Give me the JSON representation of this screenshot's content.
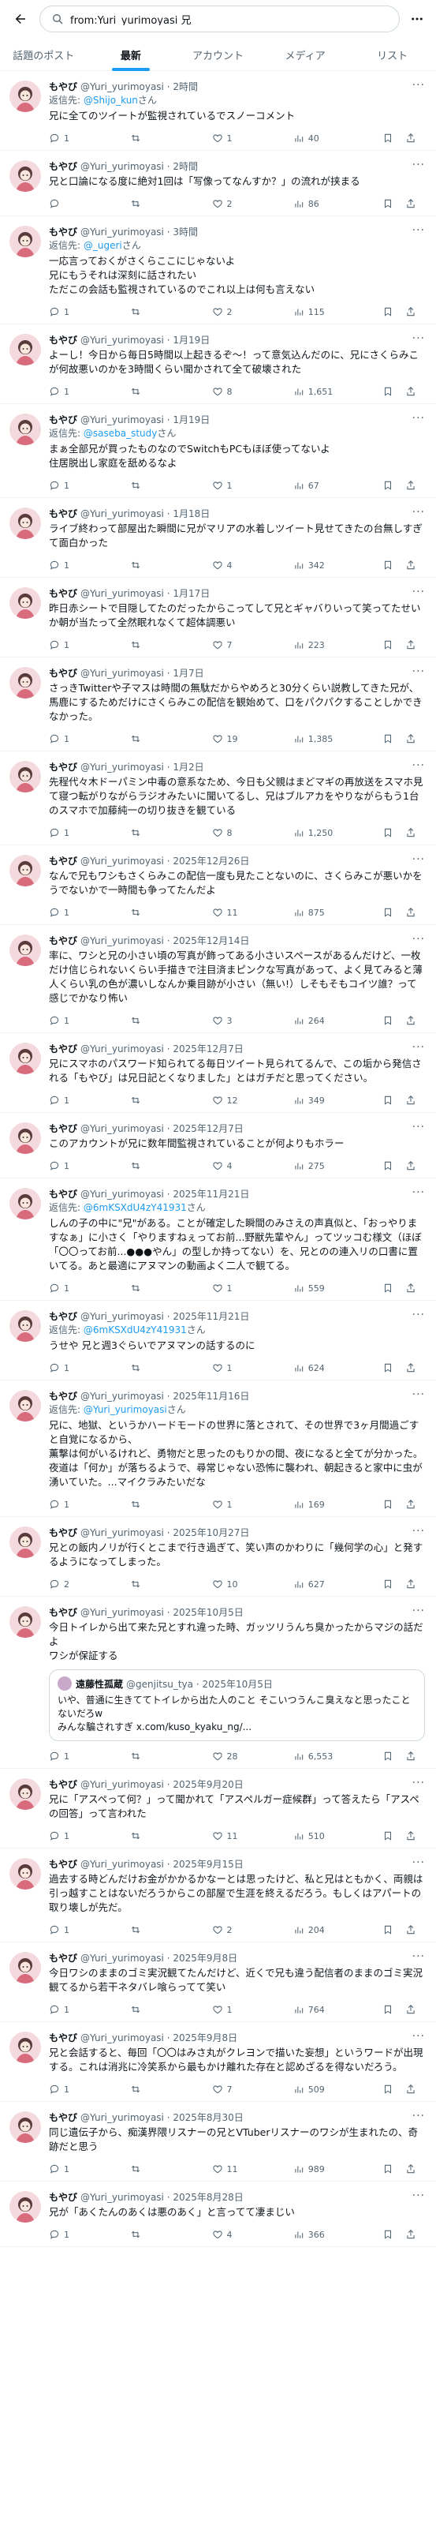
{
  "search": {
    "value": "from:Yuri_yurimoyasi 兄"
  },
  "tabs": [
    {
      "label": "話題のポスト"
    },
    {
      "label": "最新"
    },
    {
      "label": "アカウント"
    },
    {
      "label": "メディア"
    },
    {
      "label": "リスト"
    }
  ],
  "reply_prefix": "返信先:",
  "tweets": [
    {
      "name": "もやび",
      "handle": "@Yuri_yurimoyasi · 2時間",
      "reply_to": "@Shijo_kun",
      "reply_suffix": "さん",
      "text": "兄に全てのツイートが監視されているでスノーコメント",
      "replies": "1",
      "reposts": "",
      "likes": "1",
      "views": "40"
    },
    {
      "name": "もやび",
      "handle": "@Yuri_yurimoyasi · 2時間",
      "reply_to": "",
      "reply_suffix": "",
      "text": "兄と口論になる度に絶対1回は「写像ってなんすか？」の流れが挟まる",
      "replies": "",
      "reposts": "",
      "likes": "2",
      "views": "86"
    },
    {
      "name": "もやび",
      "handle": "@Yuri_yurimoyasi · 3時間",
      "reply_to": "@_ugeri",
      "reply_suffix": "さん",
      "text": "一応言っておくがさくらここにじゃないよ\n兄にもうそれは深刻に話されたい\nただこの会話も監視されているのでこれ以上は何も言えない",
      "replies": "1",
      "reposts": "",
      "likes": "2",
      "views": "115"
    },
    {
      "name": "もやび",
      "handle": "@Yuri_yurimoyasi · 1月19日",
      "reply_to": "",
      "reply_suffix": "",
      "text": "よーし！今日から毎日5時間以上起きるぞ〜！って意気込んだのに、兄にさくらみこが何故悪いのかを3時間くらい聞かされて全て破壊された",
      "replies": "1",
      "reposts": "",
      "likes": "8",
      "views": "1,651"
    },
    {
      "name": "もやび",
      "handle": "@Yuri_yurimoyasi · 1月19日",
      "reply_to": "@saseba_study",
      "reply_suffix": "さん",
      "text": "まぁ全部兄が買ったものなのでSwitchもPCもほぼ使ってないよ\n住居脱出し家庭を舐めるなよ",
      "replies": "1",
      "reposts": "",
      "likes": "1",
      "views": "67"
    },
    {
      "name": "もやび",
      "handle": "@Yuri_yurimoyasi · 1月18日",
      "reply_to": "",
      "reply_suffix": "",
      "text": "ライブ終わって部屋出た瞬間に兄がマリアの水着しツイート見せてきたの台無しすぎて面白かった",
      "replies": "1",
      "reposts": "",
      "likes": "4",
      "views": "342"
    },
    {
      "name": "もやび",
      "handle": "@Yuri_yurimoyasi · 1月17日",
      "reply_to": "",
      "reply_suffix": "",
      "text": "昨日赤シートで目隠してたのだったからこってして兄とギャバりいって笑ってたせいか朝が当たって全然眠れなくて超体調悪い",
      "replies": "1",
      "reposts": "",
      "likes": "7",
      "views": "223"
    },
    {
      "name": "もやび",
      "handle": "@Yuri_yurimoyasi · 1月7日",
      "reply_to": "",
      "reply_suffix": "",
      "text": "さっきTwitterや子マスは時間の無駄だからやめろと30分くらい説教してきた兄が、馬鹿にするためだけにさくらみこの配信を観始めて、口をパクパクすることしかできなかった。",
      "replies": "1",
      "reposts": "",
      "likes": "19",
      "views": "1,385"
    },
    {
      "name": "もやび",
      "handle": "@Yuri_yurimoyasi · 1月2日",
      "reply_to": "",
      "reply_suffix": "",
      "text": "先程代々木ドーパミン中毒の意系なため、今日も父親はまどマギの再放送をスマホ見て寝つ転がりながらラジオみたいに聞いてるし、兄はブルアカをやりながらもう1台のスマホで加藤純一の切り抜きを観ている",
      "replies": "1",
      "reposts": "",
      "likes": "8",
      "views": "1,250"
    },
    {
      "name": "もやび",
      "handle": "@Yuri_yurimoyasi · 2025年12月26日",
      "reply_to": "",
      "reply_suffix": "",
      "text": "なんで兄もワシもさくらみこの配信一度も見たことないのに、さくらみこが悪いかをうでないかで一時間も争ってたんだよ",
      "replies": "1",
      "reposts": "",
      "likes": "11",
      "views": "875"
    },
    {
      "name": "もやび",
      "handle": "@Yuri_yurimoyasi · 2025年12月14日",
      "reply_to": "",
      "reply_suffix": "",
      "text": "率に、ワシと兄の小さい頃の写真が飾ってある小さいスペースがあるんだけど、一枚だけ信じられないくらい手描きで注目済まピンクな写真があって、よく見てみると薄人くらい乳の色が濃いしなんか乗目跡が小さい（無い!）しそもそもコイツ誰？って感じでかなり怖い",
      "replies": "1",
      "reposts": "",
      "likes": "3",
      "views": "264"
    },
    {
      "name": "もやび",
      "handle": "@Yuri_yurimoyasi · 2025年12月7日",
      "reply_to": "",
      "reply_suffix": "",
      "text": "兄にスマホのパスワード知られてる毎日ツイート見られてるんで、この垢から発信される「もやび」は兄日記とくなりました」とはガチだと思ってください。",
      "replies": "1",
      "reposts": "",
      "likes": "12",
      "views": "349"
    },
    {
      "name": "もやび",
      "handle": "@Yuri_yurimoyasi · 2025年12月7日",
      "reply_to": "",
      "reply_suffix": "",
      "text": "このアカウントが兄に数年間監視されていることが何よりもホラー",
      "replies": "1",
      "reposts": "",
      "likes": "4",
      "views": "275"
    },
    {
      "name": "もやび",
      "handle": "@Yuri_yurimoyasi · 2025年11月21日",
      "reply_to": "@6mKSXdU4zY41931",
      "reply_suffix": "さん",
      "text": "しんの子の中に\"兄\"がある。ことが確定した瞬間のみさえの声真似と、「おっやりますなぁ」に小さく「やりますねぇってお前...野獣先輩やん」ってツッコむ様文（ほぼ「〇〇ってお前...●●●やん」の型しか持ってない）を、兄とのの連入リの口書に置いてる。あと最適にアヌマンの動画よく二人で観てる。",
      "replies": "1",
      "reposts": "",
      "likes": "1",
      "views": "559"
    },
    {
      "name": "もやび",
      "handle": "@Yuri_yurimoyasi · 2025年11月21日",
      "reply_to": "@6mKSXdU4zY41931",
      "reply_suffix": "さん",
      "text": "うせや 兄と週3ぐらいでアヌマンの話するのに",
      "replies": "1",
      "reposts": "",
      "likes": "1",
      "views": "624"
    },
    {
      "name": "もやび",
      "handle": "@Yuri_yurimoyasi · 2025年11月16日",
      "reply_to": "@Yuri_yurimoyasi",
      "reply_suffix": "さん",
      "text": "兄に、地獄、というかハードモードの世界に落とされて、その世界で3ヶ月間過ごすと自覚になるから、\n薫撃は何がいるけれど、勇物だと思ったのもりかの間、夜になると全てが分かった。夜道は「何か」が落ちるようで、尋常じゃない恐怖に襲われ、朝起きると家中に虫が湧いていた。...マイクラみたいだな",
      "replies": "1",
      "reposts": "",
      "likes": "1",
      "views": "169"
    },
    {
      "name": "もやび",
      "handle": "@Yuri_yurimoyasi · 2025年10月27日",
      "reply_to": "",
      "reply_suffix": "",
      "text": "兄との飯内ノリが行くとこまで行き過ぎて、笑い声のかわりに「幾何学の心」と発するようになってしまった。",
      "replies": "2",
      "reposts": "",
      "likes": "10",
      "views": "627"
    },
    {
      "name": "もやび",
      "handle": "@Yuri_yurimoyasi · 2025年10月5日",
      "reply_to": "",
      "reply_suffix": "",
      "text": "今日トイレから出て来た兄とすれ違った時、ガッツリうんち臭かったからマジの話だよ\nワシが保証する",
      "replies": "1",
      "reposts": "",
      "likes": "28",
      "views": "6,553",
      "quote": {
        "name": "遠藤性孤蔵",
        "handle": "@genjitsu_tya · 2025年10月5日",
        "text": "いや、普通に生きててトイレから出た人のこと そこいつうんこ臭えなと思ったことないだろw\nみんな騙されすぎ x.com/kuso_kyaku_ng/..."
      }
    },
    {
      "name": "もやび",
      "handle": "@Yuri_yurimoyasi · 2025年9月20日",
      "reply_to": "",
      "reply_suffix": "",
      "text": "兄に「アスペって何？」って聞かれて「アスペルガー症候群」って答えたら「アスペの回答」って言われた",
      "replies": "1",
      "reposts": "",
      "likes": "11",
      "views": "510"
    },
    {
      "name": "もやび",
      "handle": "@Yuri_yurimoyasi · 2025年9月15日",
      "reply_to": "",
      "reply_suffix": "",
      "text": "過去する時どんだけお金がかかるかなーとは思ったけど、私と兄はともかく、両親は引っ越すことはないだろうからこの部屋で生涯を終えるだろう。もしくはアパートの取り壊しが先だ。",
      "replies": "1",
      "reposts": "",
      "likes": "2",
      "views": "204"
    },
    {
      "name": "もやび",
      "handle": "@Yuri_yurimoyasi · 2025年9月8日",
      "reply_to": "",
      "reply_suffix": "",
      "text": "今日ワシのままのゴミ実況観てたんだけど、近くで兄も違う配信者のままのゴミ実況観てるから若干ネタバレ喰らってて笑い",
      "replies": "1",
      "reposts": "",
      "likes": "1",
      "views": "764"
    },
    {
      "name": "もやび",
      "handle": "@Yuri_yurimoyasi · 2025年9月8日",
      "reply_to": "",
      "reply_suffix": "",
      "text": "兄と会話すると、毎回「〇〇はみさ丸がクレヨンで描いた妄想」というワードが出現する。これは消兆に冷笑系から最もかけ離れた存在と認めざるを得ないだろう。",
      "replies": "1",
      "reposts": "",
      "likes": "7",
      "views": "509"
    },
    {
      "name": "もやび",
      "handle": "@Yuri_yurimoyasi · 2025年8月30日",
      "reply_to": "",
      "reply_suffix": "",
      "text": "同じ遺伝子から、痴漢界隈リスナーの兄とVTuberリスナーのワシが生まれたの、奇跡だと思う",
      "replies": "1",
      "reposts": "",
      "likes": "11",
      "views": "989"
    },
    {
      "name": "もやび",
      "handle": "@Yuri_yurimoyasi · 2025年8月28日",
      "reply_to": "",
      "reply_suffix": "",
      "text": "兄が「あくたんのあくは悪のあく」と言ってて凄まじい",
      "replies": "1",
      "reposts": "",
      "likes": "4",
      "views": "366"
    }
  ]
}
